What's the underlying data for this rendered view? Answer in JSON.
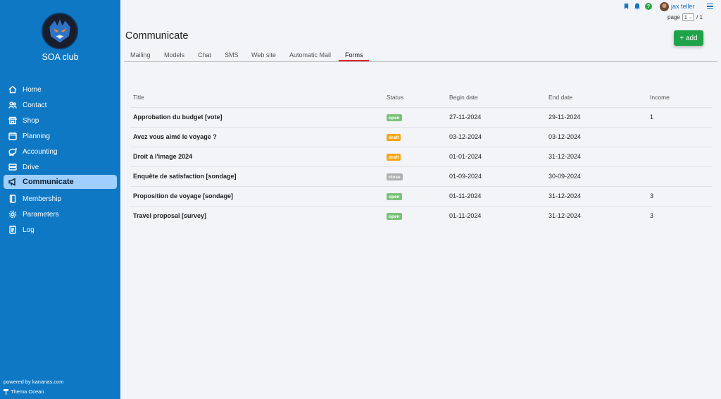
{
  "sidebar": {
    "club_name": "SOA club",
    "items": [
      {
        "label": "Home",
        "icon": "home-icon"
      },
      {
        "label": "Contact",
        "icon": "contact-icon"
      },
      {
        "label": "Shop",
        "icon": "shop-icon"
      },
      {
        "label": "Planning",
        "icon": "calendar-icon"
      },
      {
        "label": "Accounting",
        "icon": "accounting-icon"
      },
      {
        "label": "Drive",
        "icon": "drive-icon"
      },
      {
        "label": "Communicate",
        "icon": "megaphone-icon",
        "active": true
      },
      {
        "label": "Membership",
        "icon": "membership-icon"
      },
      {
        "label": "Parameters",
        "icon": "gear-icon"
      },
      {
        "label": "Log",
        "icon": "log-icon"
      }
    ],
    "powered_by": "powered by kananas.com",
    "theme": "Thema Ocean",
    "color": "#0f78c4",
    "active_color": "#9fcfff"
  },
  "topbar": {
    "username": "jax teller",
    "help": "?",
    "page_label": "page",
    "page_value": "1",
    "page_total": "/ 1"
  },
  "main": {
    "title": "Communicate",
    "add_label": "+ add",
    "tabs": [
      "Mailing",
      "Models",
      "Chat",
      "SMS",
      "Web site",
      "Automatic Mail",
      "Forms"
    ],
    "active_tab": "Forms",
    "columns": [
      "Title",
      "Status",
      "Begin date",
      "End date",
      "Income"
    ],
    "rows": [
      {
        "title": "Approbation du budget [vote]",
        "status": "open",
        "begin": "27-11-2024",
        "end": "29-11-2024",
        "income": "1"
      },
      {
        "title": "Avez vous aimé le voyage ?",
        "status": "draft",
        "begin": "03-12-2024",
        "end": "03-12-2024",
        "income": ""
      },
      {
        "title": "Droit à l'image 2024",
        "status": "draft",
        "begin": "01-01-2024",
        "end": "31-12-2024",
        "income": ""
      },
      {
        "title": "Enquête de satisfaction [sondage]",
        "status": "close",
        "begin": "01-09-2024",
        "end": "30-09-2024",
        "income": ""
      },
      {
        "title": "Proposition de voyage [sondage]",
        "status": "open",
        "begin": "01-11-2024",
        "end": "31-12-2024",
        "income": "3"
      },
      {
        "title": "Travel proposal [survey]",
        "status": "open",
        "begin": "01-11-2024",
        "end": "31-12-2024",
        "income": "3"
      }
    ],
    "status_colors": {
      "open": "#7ac27a",
      "draft": "#f2a516",
      "close": "#b0b0b0"
    },
    "add_color": "#1fa34a",
    "tab_accent": "#e0242b"
  }
}
